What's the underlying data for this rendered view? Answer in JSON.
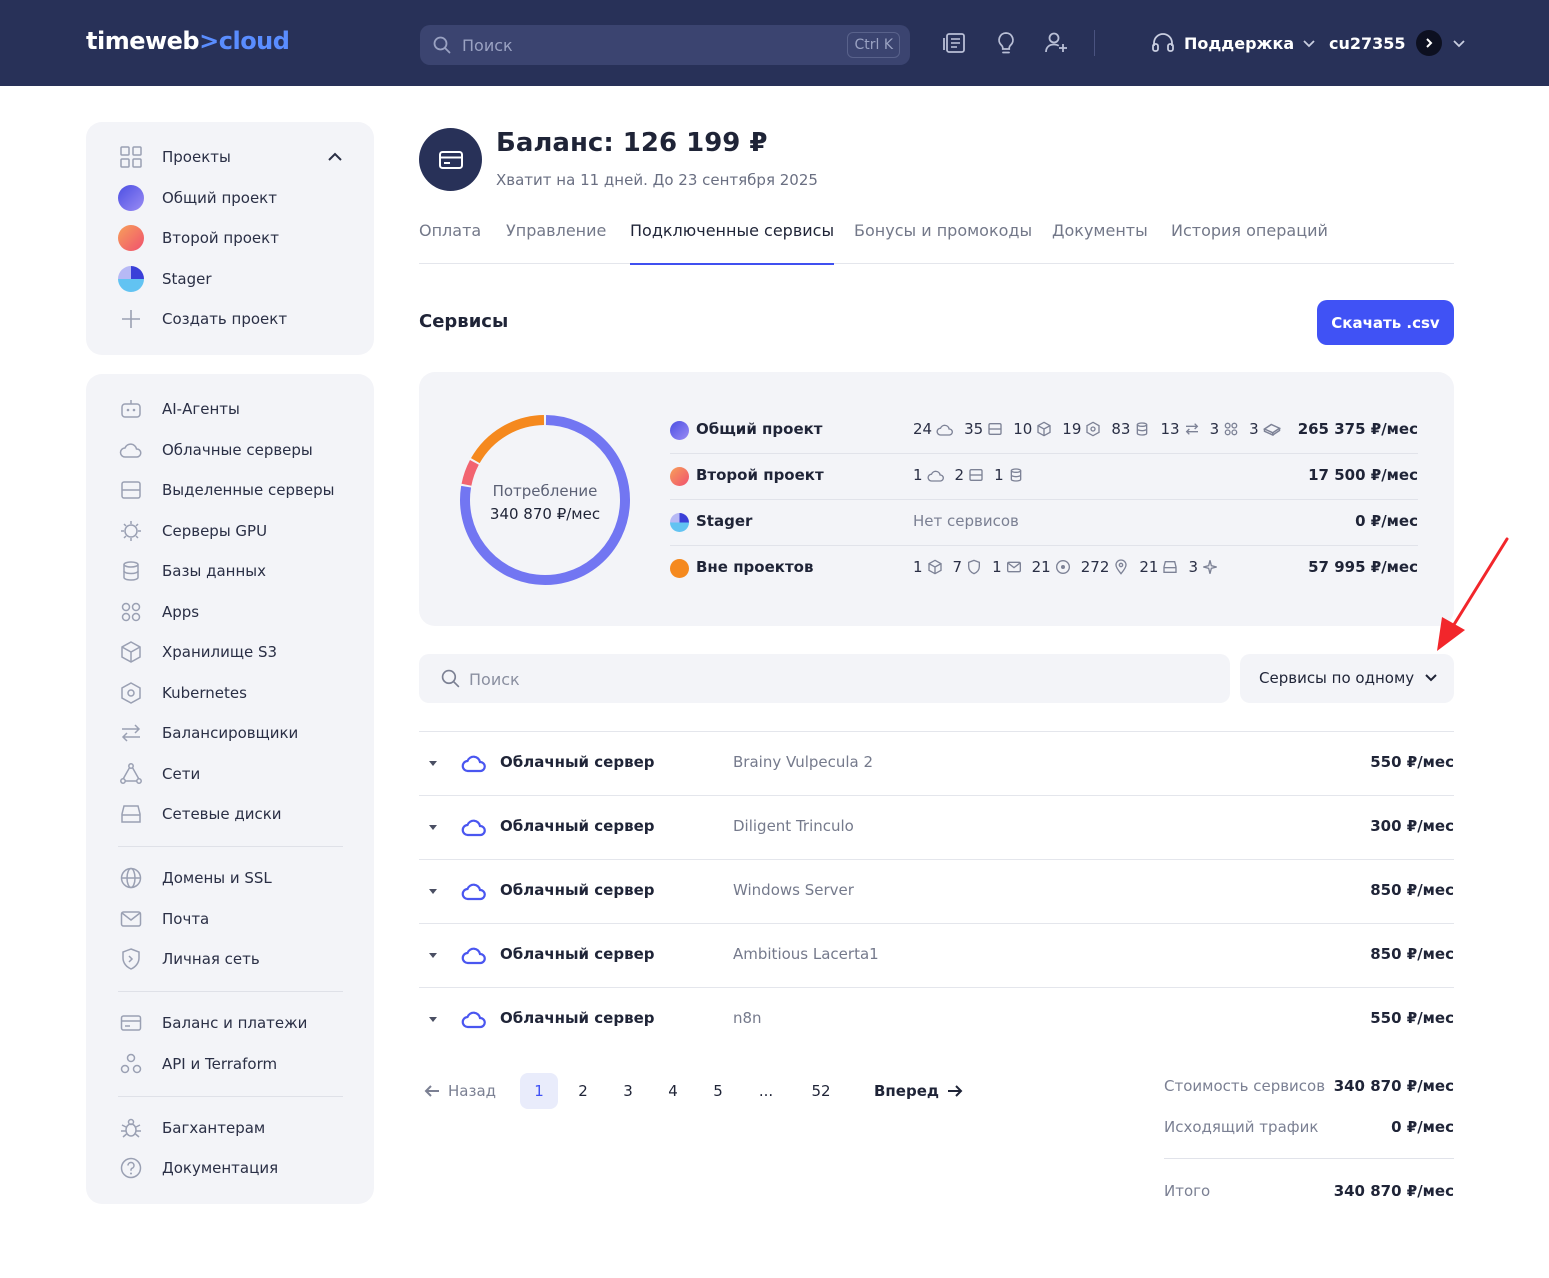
{
  "header": {
    "logo": {
      "part1": "timeweb",
      "part2": ">",
      "part3": "cloud"
    },
    "search": {
      "placeholder": "Поиск",
      "shortcut": "Ctrl K"
    },
    "icons": [
      "news-icon",
      "bulb-icon",
      "add-user-icon"
    ],
    "support_label": "Поддержка",
    "user_label": "cu27355"
  },
  "sidebar": {
    "projects_title": "Проекты",
    "projects": [
      {
        "label": "Общий проект",
        "color": "#6b6cf0"
      },
      {
        "label": "Второй проект",
        "color": "#f56d6d"
      },
      {
        "label": "Stager",
        "color": "#5ab8f0"
      }
    ],
    "create_project": "Создать проект",
    "services": [
      {
        "label": "AI-Агенты",
        "icon": "robot-icon"
      },
      {
        "label": "Облачные серверы",
        "icon": "cloud-icon"
      },
      {
        "label": "Выделенные серверы",
        "icon": "server-icon"
      },
      {
        "label": "Серверы GPU",
        "icon": "chip-icon"
      },
      {
        "label": "Базы данных",
        "icon": "database-icon"
      },
      {
        "label": "Apps",
        "icon": "apps-icon"
      },
      {
        "label": "Хранилище S3",
        "icon": "box-icon"
      },
      {
        "label": "Kubernetes",
        "icon": "kubernetes-icon"
      },
      {
        "label": "Балансировщики",
        "icon": "balancer-icon"
      },
      {
        "label": "Сети",
        "icon": "network-icon"
      },
      {
        "label": "Сетевые диски",
        "icon": "disk-icon"
      }
    ],
    "group2": [
      {
        "label": "Домены и SSL",
        "icon": "globe-icon"
      },
      {
        "label": "Почта",
        "icon": "mail-icon"
      },
      {
        "label": "Личная сеть",
        "icon": "shield-icon"
      }
    ],
    "group3": [
      {
        "label": "Баланс и платежи",
        "icon": "wallet-icon"
      },
      {
        "label": "API и Terraform",
        "icon": "api-icon"
      }
    ],
    "group4": [
      {
        "label": "Багхантерам",
        "icon": "bug-icon"
      },
      {
        "label": "Документация",
        "icon": "help-icon"
      }
    ]
  },
  "balance": {
    "title": "Баланс: 126 199 ₽",
    "subtitle": "Хватит на 11 дней. До 23 сентября 2025"
  },
  "tabs": [
    "Оплата",
    "Управление",
    "Подключенные сервисы",
    "Бонусы и промокоды",
    "Документы",
    "История операций"
  ],
  "active_tab": 2,
  "services_section": {
    "title": "Сервисы",
    "download_button": "Скачать .csv"
  },
  "consumption": {
    "label": "Потребление",
    "value": "340 870 ₽/мес",
    "segments": [
      {
        "project": "Общий проект",
        "value": 265375,
        "color": "#7276f2"
      },
      {
        "project": "Второй проект",
        "value": 17500,
        "color": "#f26470"
      },
      {
        "project": "Вне проектов",
        "value": 57995,
        "color": "#f5891e"
      }
    ]
  },
  "project_rows": [
    {
      "name": "Общий проект",
      "color": "#6b6cf0",
      "counts": [
        {
          "n": "24",
          "icon": "cloud-icon"
        },
        {
          "n": "35",
          "icon": "server-icon"
        },
        {
          "n": "10",
          "icon": "box-icon"
        },
        {
          "n": "19",
          "icon": "kubernetes-icon"
        },
        {
          "n": "83",
          "icon": "database-icon"
        },
        {
          "n": "13",
          "icon": "balancer-icon"
        },
        {
          "n": "3",
          "icon": "apps-icon"
        },
        {
          "n": "3",
          "icon": "eraser-icon"
        }
      ],
      "none": "",
      "price": "265 375 ₽/мес"
    },
    {
      "name": "Второй проект",
      "color": "#f56d6d",
      "counts": [
        {
          "n": "1",
          "icon": "cloud-icon"
        },
        {
          "n": "2",
          "icon": "server-icon"
        },
        {
          "n": "1",
          "icon": "database-icon"
        }
      ],
      "none": "",
      "price": "17 500 ₽/мес"
    },
    {
      "name": "Stager",
      "color": "#5ab8f0",
      "counts": [],
      "none": "Нет сервисов",
      "price": "0 ₽/мес"
    },
    {
      "name": "Вне проектов",
      "color": "#f5891e",
      "counts": [
        {
          "n": "1",
          "icon": "box-icon"
        },
        {
          "n": "7",
          "icon": "shield-icon"
        },
        {
          "n": "1",
          "icon": "mail-icon"
        },
        {
          "n": "21",
          "icon": "target-icon"
        },
        {
          "n": "272",
          "icon": "pin-icon"
        },
        {
          "n": "21",
          "icon": "disk-icon"
        },
        {
          "n": "3",
          "icon": "sparkle-icon"
        }
      ],
      "none": "",
      "price": "57 995 ₽/мес"
    }
  ],
  "filter": {
    "search_placeholder": "Поиск",
    "group_select": "Сервисы по одному"
  },
  "services": [
    {
      "type": "Облачный сервер",
      "name": "Brainy Vulpecula 2",
      "price": "550 ₽/мес"
    },
    {
      "type": "Облачный сервер",
      "name": "Diligent Trinculo",
      "price": "300 ₽/мес"
    },
    {
      "type": "Облачный сервер",
      "name": "Windows Server",
      "price": "850 ₽/мес"
    },
    {
      "type": "Облачный сервер",
      "name": "Ambitious Lacerta1",
      "price": "850 ₽/мес"
    },
    {
      "type": "Облачный сервер",
      "name": "n8n",
      "price": "550 ₽/мес"
    }
  ],
  "pagination": {
    "prev": "Назад",
    "next": "Вперед",
    "pages": [
      "1",
      "2",
      "3",
      "4",
      "5",
      "...",
      "52"
    ],
    "current": 1
  },
  "totals": {
    "services_cost_label": "Стоимость сервисов",
    "services_cost": "340 870 ₽/мес",
    "traffic_label": "Исходящий трафик",
    "traffic": "0 ₽/мес",
    "total_label": "Итого",
    "total": "340 870 ₽/мес"
  },
  "annotation_arrow_color": "#f2262b"
}
